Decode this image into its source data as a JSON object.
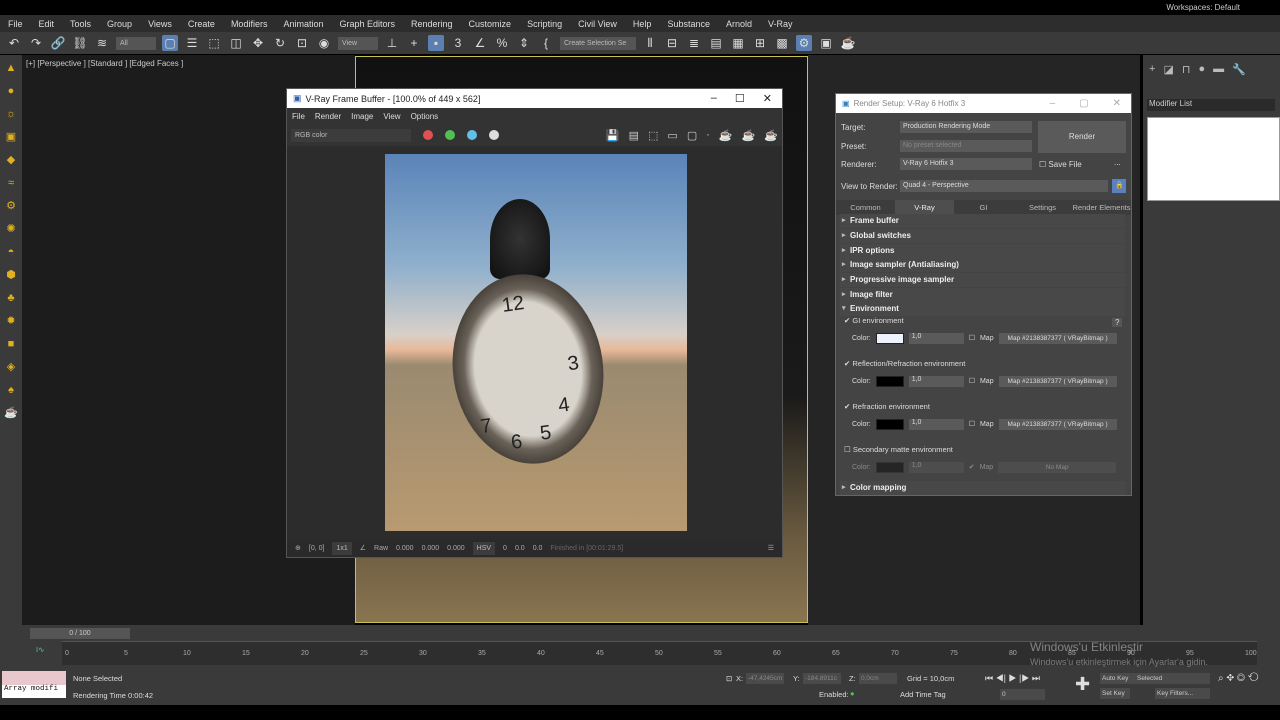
{
  "menu": [
    "File",
    "Edit",
    "Tools",
    "Group",
    "Views",
    "Create",
    "Modifiers",
    "Animation",
    "Graph Editors",
    "Rendering",
    "Customize",
    "Scripting",
    "Civil View",
    "Help",
    "Substance",
    "Arnold",
    "V-Ray"
  ],
  "workspace": "Workspaces: Default",
  "toolbar": {
    "filter": "All",
    "ref_coord": "View",
    "selection_set": "Create Selection Se"
  },
  "viewport_label": "[+] [Perspective ] [Standard ] [Edged Faces ]",
  "command_panel": {
    "modifier_list": "Modifier List"
  },
  "vfb": {
    "title": "V-Ray Frame Buffer - [100.0% of 449 x 562]",
    "menu": [
      "File",
      "Render",
      "Image",
      "View",
      "Options"
    ],
    "channel": "RGB color",
    "colors": {
      "red": "#e05050",
      "green": "#50c050",
      "blue": "#60c0e8"
    },
    "clock_numbers": [
      "12",
      "3",
      "4",
      "5",
      "6",
      "7"
    ],
    "status": {
      "coords": "[0, 0]",
      "zoom": "1x1",
      "raw": "Raw",
      "v1": "0.000",
      "v2": "0.000",
      "v3": "0.000",
      "mode": "HSV",
      "h": "0",
      "s": "0.0",
      "v": "0.0",
      "finished": "Finished in [00:01:29.5]"
    }
  },
  "render_setup": {
    "title": "Render Setup: V-Ray 6 Hotfix 3",
    "target_label": "Target:",
    "target": "Production Rendering Mode",
    "preset_label": "Preset:",
    "preset": "No preset selected",
    "renderer_label": "Renderer:",
    "renderer": "V-Ray 6 Hotfix 3",
    "save_file": "Save File",
    "view_label": "View to Render:",
    "view": "Quad 4 - Perspective",
    "render_btn": "Render",
    "more": "...",
    "tabs": [
      "Common",
      "V-Ray",
      "GI",
      "Settings",
      "Render Elements"
    ],
    "rollouts": [
      "Frame buffer",
      "Global switches",
      "IPR options",
      "Image sampler (Antialiasing)",
      "Progressive image sampler",
      "Image filter",
      "Environment",
      "Color mapping"
    ],
    "env": [
      {
        "label": "GI environment",
        "color_label": "Color:",
        "value": "1,0",
        "map_label": "Map",
        "map": "Map #2138387377  ( VRayBitmap )",
        "swatch": "#eef2ff"
      },
      {
        "label": "Reflection/Refraction environment",
        "color_label": "Color:",
        "value": "1,0",
        "map_label": "Map",
        "map": "Map #2138387377  ( VRayBitmap )",
        "swatch": "#000000"
      },
      {
        "label": "Refraction environment",
        "color_label": "Color:",
        "value": "1,0",
        "map_label": "Map",
        "map": "Map #2138387377  ( VRayBitmap )",
        "swatch": "#000000"
      },
      {
        "label": "Secondary matte environment",
        "color_label": "Color:",
        "value": "1,0",
        "map_label": "Map",
        "map": "No Map",
        "swatch": "#000000"
      }
    ],
    "help": "?"
  },
  "timeline": {
    "frame": "0 / 100",
    "ticks": [
      "0",
      "5",
      "10",
      "15",
      "20",
      "25",
      "30",
      "35",
      "40",
      "45",
      "50",
      "55",
      "60",
      "65",
      "70",
      "75",
      "80",
      "85",
      "90",
      "95",
      "100"
    ]
  },
  "status": {
    "script": "Array modifi",
    "selection": "None Selected",
    "render_time": "Rendering Time  0:00:42",
    "x_label": "X:",
    "x": "-47,4245cm",
    "y_label": "Y:",
    "y": "-184,8911c",
    "z_label": "Z:",
    "z": "0,0cm",
    "grid": "Grid = 10,0cm",
    "enabled": "Enabled:",
    "add_time_tag": "Add Time Tag",
    "frame": "0",
    "auto_key": "Auto Key",
    "selected": "Selected",
    "set_key": "Set Key",
    "key_filters": "Key Filters..."
  },
  "watermark": {
    "title": "Windows'u Etkinleştir",
    "sub": "Windows'u etkinleştirmek için Ayarlar'a gidin."
  }
}
